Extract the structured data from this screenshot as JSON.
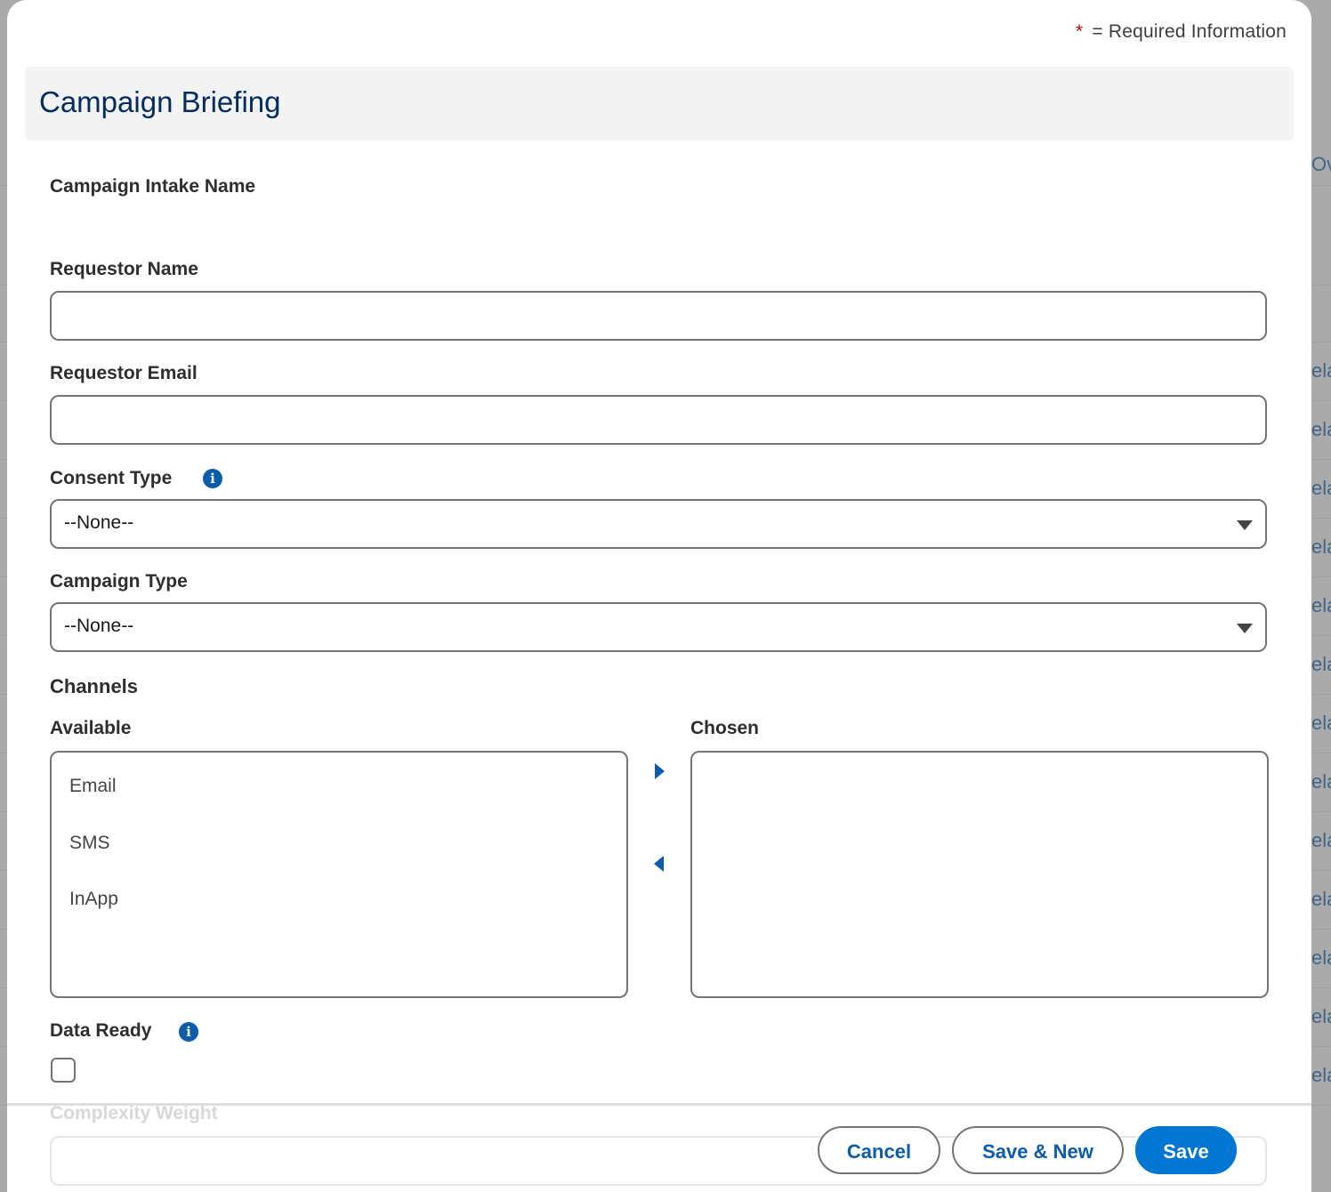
{
  "required_info": {
    "star": "*",
    "text": "= Required Information"
  },
  "section": {
    "title": "Campaign Briefing"
  },
  "fields": {
    "campaign_intake_name": {
      "label": "Campaign Intake Name"
    },
    "requestor_name": {
      "label": "Requestor Name",
      "value": ""
    },
    "requestor_email": {
      "label": "Requestor Email",
      "value": ""
    },
    "consent_type": {
      "label": "Consent Type",
      "value": "--None--"
    },
    "campaign_type": {
      "label": "Campaign Type",
      "value": "--None--"
    },
    "channels": {
      "label": "Channels",
      "available_label": "Available",
      "chosen_label": "Chosen",
      "available": [
        "Email",
        "SMS",
        "InApp"
      ],
      "chosen": []
    },
    "data_ready": {
      "label": "Data Ready",
      "checked": false
    },
    "complexity_weight": {
      "label": "Complexity Weight",
      "value": ""
    }
  },
  "buttons": {
    "cancel": "Cancel",
    "save_new": "Save & New",
    "save": "Save"
  },
  "background_fragments": [
    "Ov",
    "ela",
    "ela",
    "ela",
    "ela",
    "ela",
    "ela",
    "ela",
    "ela",
    "ela",
    "ela",
    "ela",
    "ela",
    "ela"
  ],
  "colors": {
    "brand": "#0176d3",
    "link": "#0b5cab",
    "required": "#ba0517",
    "section_title": "#032d60"
  },
  "icons": {
    "info": "info-icon",
    "move_right": "arrow-right-icon",
    "move_left": "arrow-left-icon",
    "dropdown": "chevron-down-icon"
  }
}
